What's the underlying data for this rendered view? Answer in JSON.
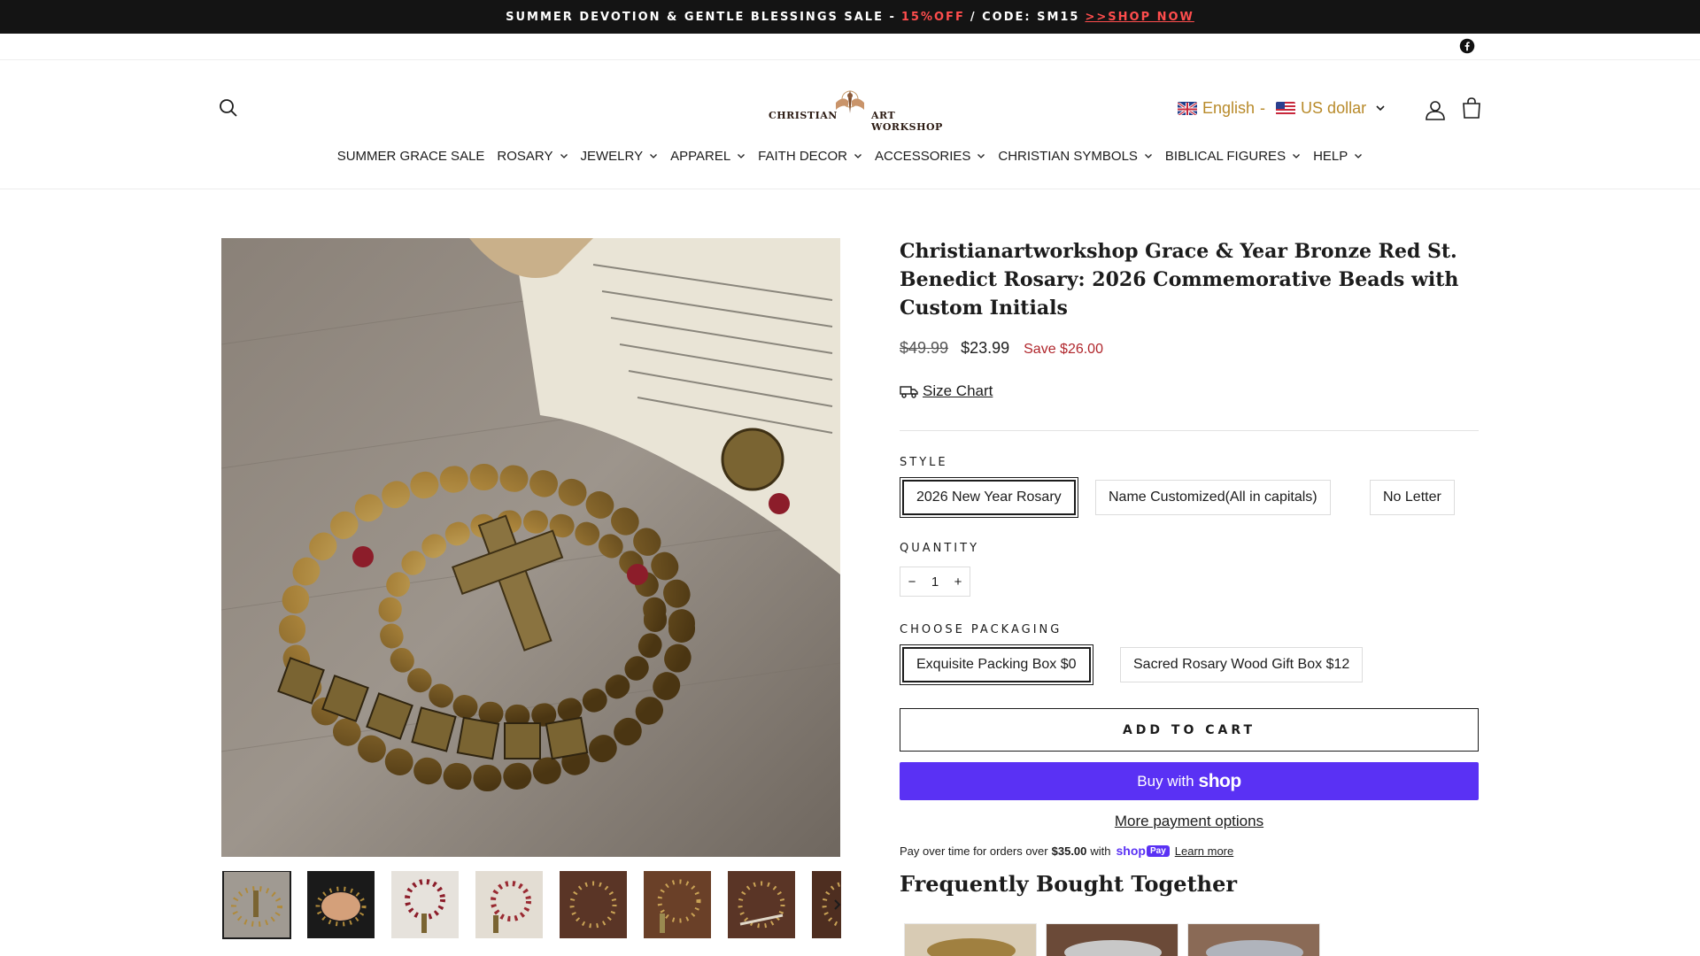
{
  "announcement": {
    "text_before": "SUMMER DEVOTION & GENTLE BLESSINGS SALE -",
    "highlight": "15%OFF",
    "text_after": "/ CODE: SM15",
    "link": ">>SHOP NOW"
  },
  "header": {
    "logo_word_left": "CHRISTIAN",
    "logo_word_right": "ART WORKSHOP",
    "language": "English",
    "separator": "-",
    "currency": "US dollar"
  },
  "nav": {
    "items": [
      {
        "label": "SUMMER GRACE SALE",
        "has_dropdown": false
      },
      {
        "label": "ROSARY",
        "has_dropdown": true
      },
      {
        "label": "JEWELRY",
        "has_dropdown": true
      },
      {
        "label": "APPAREL",
        "has_dropdown": true
      },
      {
        "label": "FAITH DECOR",
        "has_dropdown": true
      },
      {
        "label": "ACCESSORIES",
        "has_dropdown": true
      },
      {
        "label": "CHRISTIAN SYMBOLS",
        "has_dropdown": true
      },
      {
        "label": "BIBLICAL FIGURES",
        "has_dropdown": true
      },
      {
        "label": "HELP",
        "has_dropdown": true
      }
    ]
  },
  "product": {
    "title": "Christianartworkshop Grace & Year Bronze Red St. Benedict Rosary: 2026 Commemorative Beads with Custom Initials",
    "price_original": "$49.99",
    "price_sale": "$23.99",
    "savings": "Save $26.00",
    "size_chart": "Size Chart",
    "style_label": "STYLE",
    "style_options": [
      "2026 New Year Rosary",
      "Name Customized(All in capitals)",
      "No Letter"
    ],
    "style_selected_index": 0,
    "quantity_label": "QUANTITY",
    "quantity_minus": "−",
    "quantity_value": "1",
    "quantity_plus": "+",
    "packaging_label": "CHOOSE PACKAGING",
    "packaging_options": [
      "Exquisite Packing Box $0",
      "Sacred Rosary Wood Gift Box $12"
    ],
    "packaging_selected_index": 0,
    "add_to_cart": "ADD TO CART",
    "buy_with": "Buy with",
    "buy_brand": "shop",
    "more_payment": "More payment options",
    "installments_text": "Pay over time for orders over",
    "installments_amount": "$35.00",
    "installments_with": "with",
    "shoppay_word": "shop",
    "shoppay_badge": "Pay",
    "learn_more": "Learn more",
    "fbt_title": "Frequently Bought Together"
  },
  "gallery": {
    "thumbnail_count_visible": 8,
    "active_index": 0
  },
  "colors": {
    "announcement_bg": "#141414",
    "sale_red": "#ff4d4d",
    "locale_gold": "#b88a2a",
    "save_red": "#b0262c",
    "shop_purple": "#5a31f4"
  },
  "icons": [
    "facebook-icon",
    "search-icon",
    "account-icon",
    "cart-icon",
    "chevron-down-icon",
    "truck-icon",
    "chevron-right-icon"
  ]
}
